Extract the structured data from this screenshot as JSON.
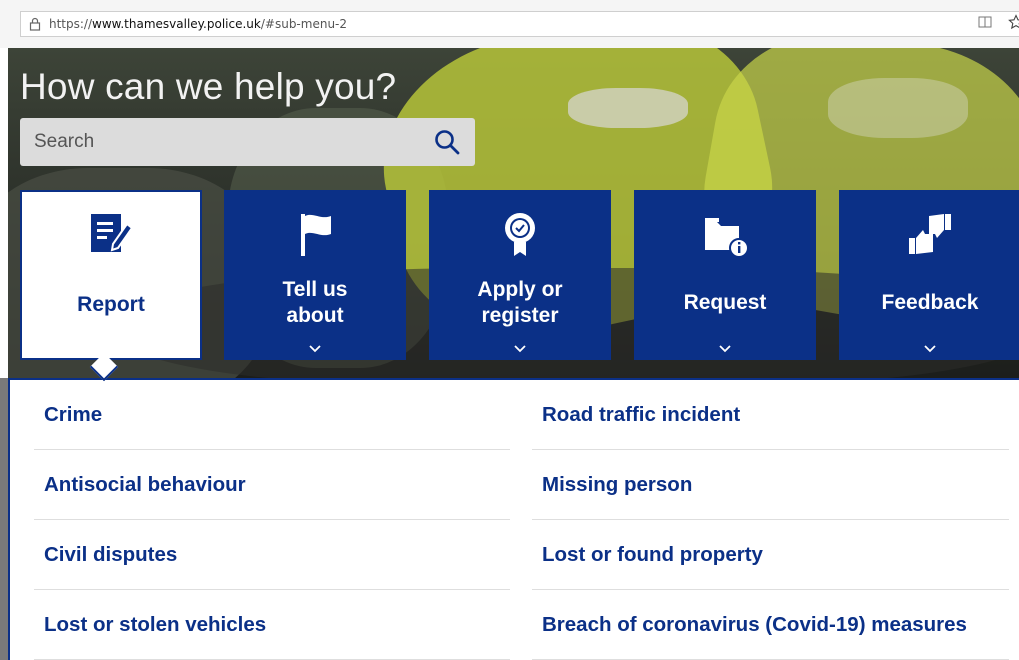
{
  "browser": {
    "url_prefix": "https://",
    "url_domain": "www.thamesvalley.police.uk",
    "url_suffix": "/#sub-menu-2",
    "icons": [
      "lock-icon",
      "reading-view-icon",
      "favorite-star-icon"
    ]
  },
  "hero": {
    "heading": "How can we help you?",
    "search_placeholder": "Search"
  },
  "tiles": [
    {
      "label": "Report",
      "icon": "report-icon",
      "active": true
    },
    {
      "label": "Tell us about",
      "icon": "flag-icon",
      "active": false
    },
    {
      "label": "Apply or register",
      "icon": "award-icon",
      "active": false
    },
    {
      "label": "Request",
      "icon": "folder-info-icon",
      "active": false
    },
    {
      "label": "Feedback",
      "icon": "thumbs-icon",
      "active": false
    }
  ],
  "submenu": {
    "left": [
      "Crime",
      "Antisocial behaviour",
      "Civil disputes",
      "Lost or stolen vehicles"
    ],
    "right": [
      "Road traffic incident",
      "Missing person",
      "Lost or found property",
      "Breach of coronavirus (Covid-19) measures"
    ]
  },
  "colors": {
    "brand_blue": "#0b3087",
    "search_bg": "#dcdcdc"
  }
}
